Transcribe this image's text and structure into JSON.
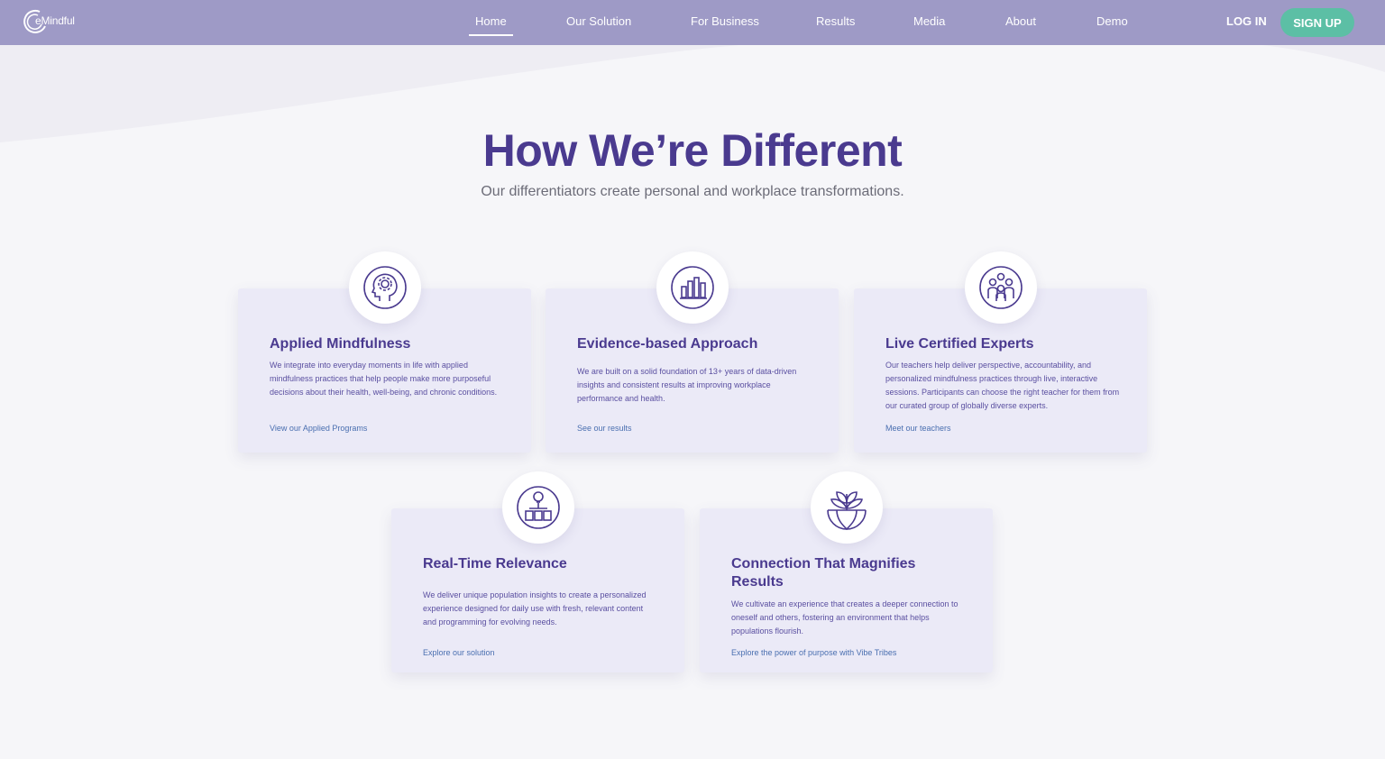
{
  "brand": {
    "name": "eMindful"
  },
  "nav": {
    "items": [
      {
        "label": "Home",
        "active": true
      },
      {
        "label": "Our Solution"
      },
      {
        "label": "For Business"
      },
      {
        "label": "Results"
      },
      {
        "label": "Media"
      },
      {
        "label": "About"
      },
      {
        "label": "Demo"
      }
    ],
    "login_label": "LOG IN",
    "signup_label": "SIGN UP"
  },
  "section": {
    "title": "How We’re Different",
    "subtitle": "Our differentiators create personal and workplace transformations."
  },
  "cards": [
    {
      "icon": "head-gear-icon",
      "title": "Applied Mindfulness",
      "text": "We integrate into everyday moments in life with applied mindfulness practices that help people make more purposeful decisions about their health, well-being, and chronic conditions.",
      "link": "View our Applied Programs"
    },
    {
      "icon": "bar-chart-icon",
      "title": "Evidence-based Approach",
      "text": "We are built on a solid foundation of 13+ years of data-driven insights and consistent results at improving workplace performance and health.",
      "link": "See our results"
    },
    {
      "icon": "people-group-icon",
      "title": "Live Certified Experts",
      "text": "Our teachers help deliver perspective, accountability, and personalized mindfulness practices through live, interactive sessions. Participants can choose the right teacher for them from our curated group of globally diverse experts.",
      "link": "Meet our teachers"
    },
    {
      "icon": "lightbulb-devices-icon",
      "title": "Real-Time Relevance",
      "text": "We deliver unique population insights to create a personalized experience designed for daily use with fresh, relevant content and programming for evolving needs.",
      "link": "Explore our solution"
    },
    {
      "icon": "globe-plant-icon",
      "title": "Connection That Magnifies Results",
      "text": "We cultivate an experience that creates a deeper connection to oneself and others, fostering an environment that helps populations flourish.",
      "link": "Explore the power of purpose with Vibe Tribes"
    }
  ],
  "colors": {
    "nav_bg": "#9e9ac6",
    "primary": "#4a3a8f",
    "signup": "#5cbfa5",
    "card_bg": "#ebeaf7",
    "link": "#4a6fb0"
  }
}
